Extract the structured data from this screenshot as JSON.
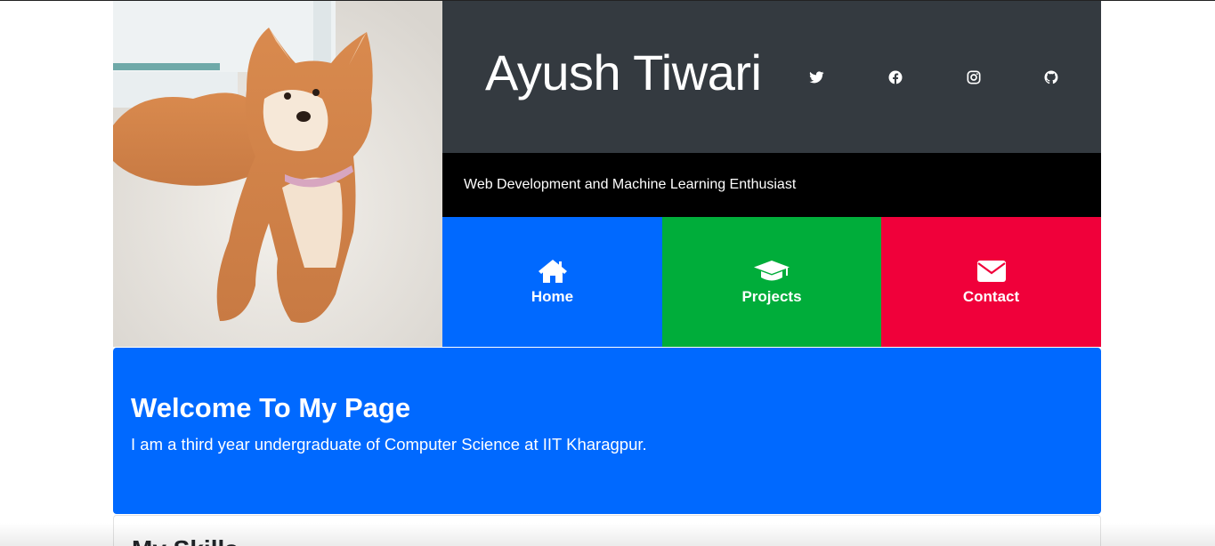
{
  "header": {
    "name": "Ayush Tiwari",
    "tagline": "Web Development and Machine Learning Enthusiast"
  },
  "social": [
    {
      "icon": "twitter-icon"
    },
    {
      "icon": "facebook-icon"
    },
    {
      "icon": "instagram-icon"
    },
    {
      "icon": "github-icon"
    }
  ],
  "nav": {
    "home": {
      "label": "Home",
      "icon": "home-icon",
      "color": "#0069ff"
    },
    "projects": {
      "label": "Projects",
      "icon": "graduation-cap-icon",
      "color": "#00ad3a"
    },
    "contact": {
      "label": "Contact",
      "icon": "envelope-icon",
      "color": "#f0003a"
    }
  },
  "welcome": {
    "title": "Welcome To My Page",
    "text": "I am a third year undergraduate of Computer Science at IIT Kharagpur."
  },
  "skills": {
    "title": "My Skills"
  },
  "colors": {
    "header_bg": "#343a40",
    "tagline_bg": "#000000",
    "welcome_bg": "#0069ff"
  }
}
